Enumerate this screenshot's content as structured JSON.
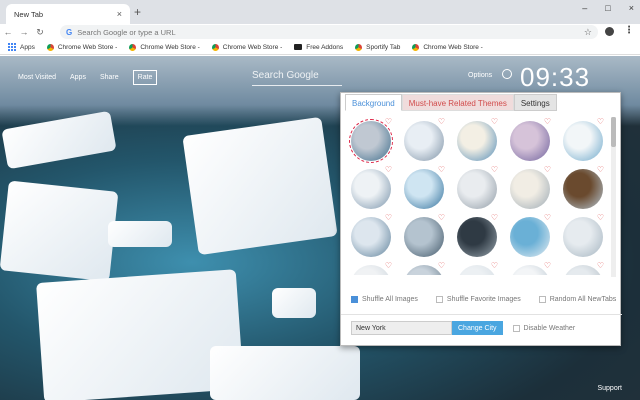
{
  "browser": {
    "tab_title": "New Tab",
    "tab_close": "×",
    "new_tab": "+",
    "win_min": "–",
    "win_max": "□",
    "win_close": "×",
    "omnibox_placeholder": "Search Google or type a URL",
    "g_glyph": "G",
    "bookmarks": [
      {
        "label": "Apps",
        "icon": "apps-icon"
      },
      {
        "label": "Chrome Web Store -",
        "icon": "chrome-store-icon"
      },
      {
        "label": "Chrome Web Store -",
        "icon": "chrome-store-icon"
      },
      {
        "label": "Chrome Web Store -",
        "icon": "chrome-store-icon"
      },
      {
        "label": "Free Addons",
        "icon": "film-icon"
      },
      {
        "label": "Sportify Tab",
        "icon": "chrome-store-icon"
      },
      {
        "label": "Chrome Web Store -",
        "icon": "chrome-store-icon"
      }
    ]
  },
  "newtab": {
    "links": [
      "Most Visited",
      "Apps",
      "Share"
    ],
    "rate": "Rate",
    "search_placeholder": "Search Google",
    "options": "Options",
    "clock": "09:33",
    "support": "Support"
  },
  "panel": {
    "tabs": [
      "Background",
      "Must-have Related Themes",
      "Settings"
    ],
    "thumbs": [
      {
        "c1": "#c0c8d2",
        "c2": "#3b6b8a",
        "selected": true
      },
      {
        "c1": "#e8eef4",
        "c2": "#7a8fa3"
      },
      {
        "c1": "#f3efe4",
        "c2": "#4f89b5"
      },
      {
        "c1": "#d6c3d9",
        "c2": "#6c5f9b"
      },
      {
        "c1": "#f2f6f8",
        "c2": "#6aa6c9"
      },
      {
        "c1": "#eef2f5",
        "c2": "#7590a8"
      },
      {
        "c1": "#cfe5f2",
        "c2": "#2e6e9a"
      },
      {
        "c1": "#e9ecef",
        "c2": "#8d99a4"
      },
      {
        "c1": "#f1ede4",
        "c2": "#9aa8b3"
      },
      {
        "c1": "#6a4a2e",
        "c2": "#b7c9d6"
      },
      {
        "c1": "#dde6ee",
        "c2": "#5c7f99"
      },
      {
        "c1": "#b4c3cf",
        "c2": "#3f5566"
      },
      {
        "c1": "#2f3a44",
        "c2": "#9aa7b0"
      },
      {
        "c1": "#6ab0d6",
        "c2": "#e8eef2"
      },
      {
        "c1": "#e6ebef",
        "c2": "#a3b3bf"
      },
      {
        "c1": "#f0f2f4",
        "c2": "#c8d2da"
      },
      {
        "c1": "#c9d3dc",
        "c2": "#5e7384"
      },
      {
        "c1": "#ecf0f3",
        "c2": "#d1dae1"
      },
      {
        "c1": "#f3f5f7",
        "c2": "#b6c4cf"
      },
      {
        "c1": "#e5eaee",
        "c2": "#aeb9c2"
      }
    ],
    "heart": "♡",
    "shuffle_all": "Shuffle All Images",
    "shuffle_fav": "Shuffle Favorite Images",
    "random_all": "Random All NewTabs",
    "city_value": "New York",
    "change_city": "Change City",
    "disable_weather": "Disable Weather"
  }
}
